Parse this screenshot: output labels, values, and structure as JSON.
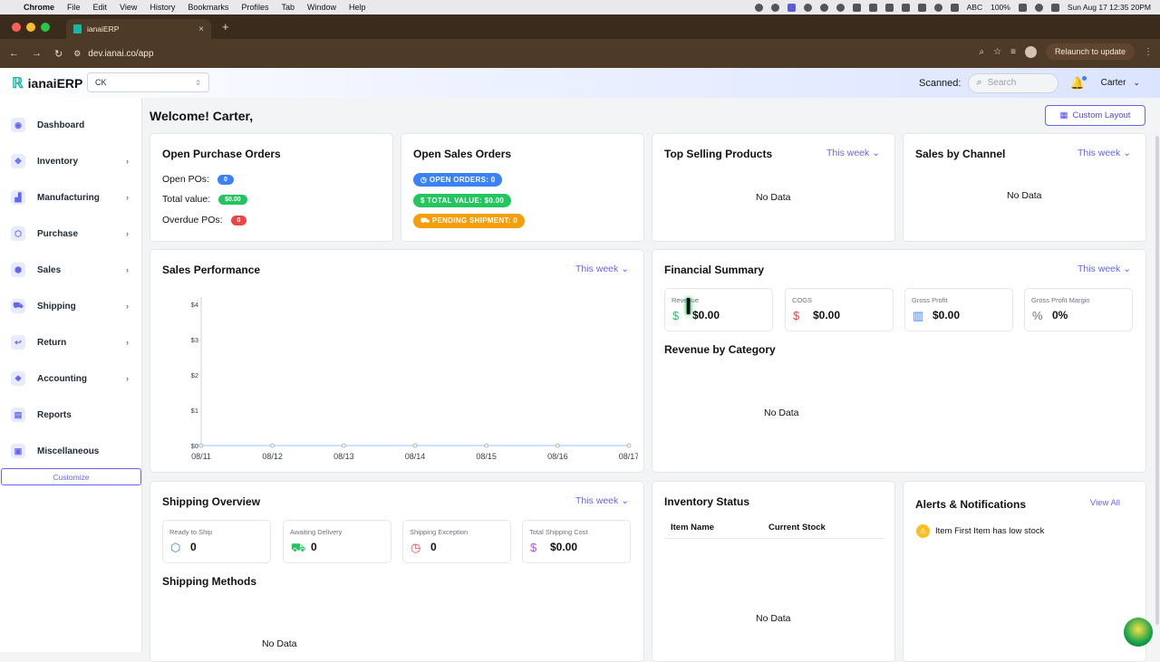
{
  "macos": {
    "menu": [
      "Chrome",
      "File",
      "Edit",
      "View",
      "History",
      "Bookmarks",
      "Profiles",
      "Tab",
      "Window",
      "Help"
    ],
    "status": {
      "input": "ABC",
      "battery": "100%",
      "datetime": "Sun Aug 17  12:35 20PM"
    }
  },
  "browser": {
    "tab_title": "ianaiERP",
    "url": "dev.ianai.co/app",
    "relaunch": "Relaunch to update"
  },
  "header": {
    "brand": "ianaiERP",
    "company": "CK",
    "scanned_label": "Scanned:",
    "search_placeholder": "Search",
    "user": "Carter"
  },
  "sidebar": {
    "items": [
      {
        "label": "Dashboard",
        "icon": "dashboard-icon",
        "expandable": false
      },
      {
        "label": "Inventory",
        "icon": "inventory-icon",
        "expandable": true
      },
      {
        "label": "Manufacturing",
        "icon": "factory-icon",
        "expandable": true
      },
      {
        "label": "Purchase",
        "icon": "purchase-icon",
        "expandable": true
      },
      {
        "label": "Sales",
        "icon": "sales-icon",
        "expandable": true
      },
      {
        "label": "Shipping",
        "icon": "truck-icon",
        "expandable": true
      },
      {
        "label": "Return",
        "icon": "return-icon",
        "expandable": true
      },
      {
        "label": "Accounting",
        "icon": "accounting-icon",
        "expandable": true
      },
      {
        "label": "Reports",
        "icon": "reports-icon",
        "expandable": false
      },
      {
        "label": "Miscellaneous",
        "icon": "misc-icon",
        "expandable": false
      }
    ],
    "customize": "Customize"
  },
  "main": {
    "welcome": "Welcome! Carter,",
    "custom_layout": "Custom Layout",
    "period": "This week",
    "no_data": "No Data",
    "open_po": {
      "title": "Open Purchase Orders",
      "open_label": "Open POs:",
      "open_value": "0",
      "total_label": "Total value:",
      "total_value": "$0.00",
      "overdue_label": "Overdue POs:",
      "overdue_value": "0"
    },
    "open_so": {
      "title": "Open Sales Orders",
      "open_orders": "OPEN ORDERS: 0",
      "total_value": "TOTAL VALUE: $0.00",
      "pending": "PENDING SHIPMENT: 0"
    },
    "top_selling": {
      "title": "Top Selling Products"
    },
    "sales_channel": {
      "title": "Sales by Channel"
    },
    "sales_perf": {
      "title": "Sales Performance"
    },
    "financial": {
      "title": "Financial Summary",
      "cards": [
        {
          "label": "Revenue",
          "value": "$0.00",
          "icon": "dollar-icon"
        },
        {
          "label": "COGS",
          "value": "$0.00",
          "icon": "dollar-icon"
        },
        {
          "label": "Gross Profit",
          "value": "$0.00",
          "icon": "bar-chart-icon"
        },
        {
          "label": "Gross Profit Margin",
          "value": "0%",
          "icon": "percent-icon"
        }
      ],
      "revenue_by_category": "Revenue by Category"
    },
    "shipping": {
      "title": "Shipping Overview",
      "cards": [
        {
          "label": "Ready to Ship",
          "value": "0",
          "icon": "box-icon"
        },
        {
          "label": "Awaiting Delivery",
          "value": "0",
          "icon": "truck-icon"
        },
        {
          "label": "Shipping Exception",
          "value": "0",
          "icon": "clock-icon"
        },
        {
          "label": "Total Shipping Cost",
          "value": "$0.00",
          "icon": "dollar-icon"
        }
      ],
      "methods_title": "Shipping Methods"
    },
    "inventory_status": {
      "title": "Inventory Status",
      "col1": "Item Name",
      "col2": "Current Stock"
    },
    "alerts": {
      "title": "Alerts & Notifications",
      "view_all": "View All",
      "item": "Item First Item has low stock"
    }
  },
  "chart_data": {
    "type": "line",
    "x": [
      "08/11",
      "08/12",
      "08/13",
      "08/14",
      "08/15",
      "08/16",
      "08/17"
    ],
    "series": [
      {
        "values": [
          0,
          0,
          0,
          0,
          0,
          0,
          0
        ]
      }
    ],
    "yticks": [
      "$0",
      "$1",
      "$2",
      "$3",
      "$4"
    ],
    "ylim": [
      0,
      4
    ]
  },
  "colors": {
    "accent": "#6366f1",
    "teal": "#14b8a6",
    "blue": "#3b82f6",
    "green": "#22c55e",
    "red": "#ef4444",
    "amber": "#f59e0b"
  }
}
